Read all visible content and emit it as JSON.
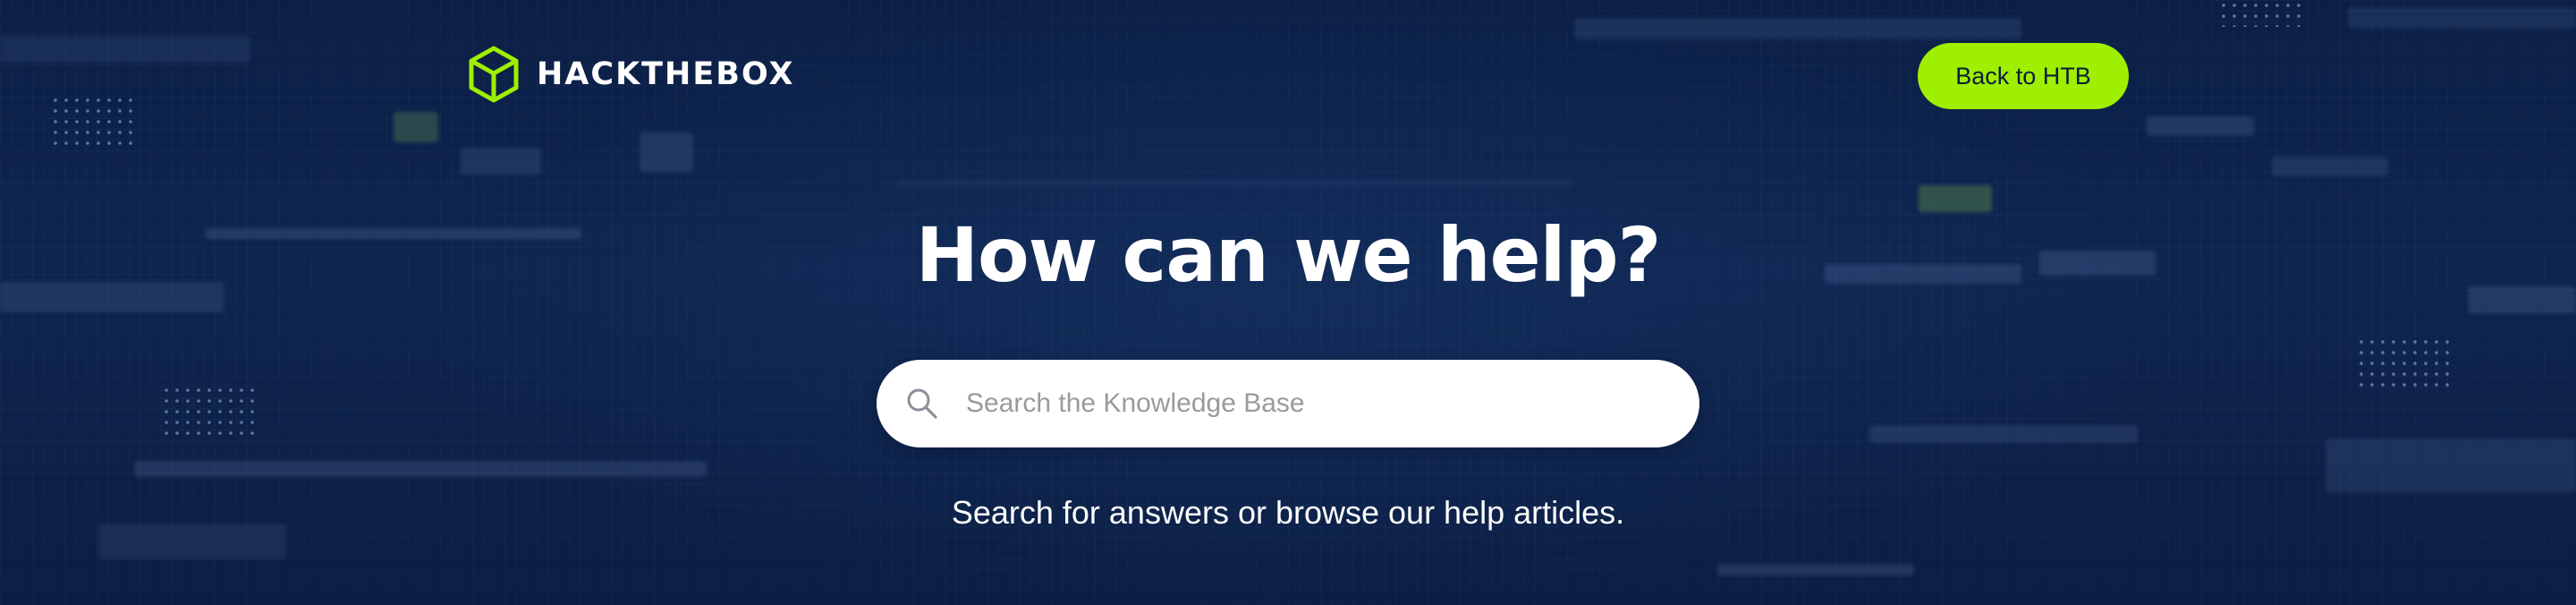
{
  "header": {
    "logo_text": "HACKTHEBOX",
    "logo_icon": "cube-icon",
    "back_button_label": "Back to HTB"
  },
  "hero": {
    "title": "How can we help?",
    "search": {
      "placeholder": "Search the Knowledge Base",
      "value": "",
      "icon": "search-icon"
    },
    "subtitle": "Search for answers or browse our help articles."
  },
  "colors": {
    "background": "#0d2148",
    "accent": "#9fef00",
    "text": "#ffffff"
  }
}
